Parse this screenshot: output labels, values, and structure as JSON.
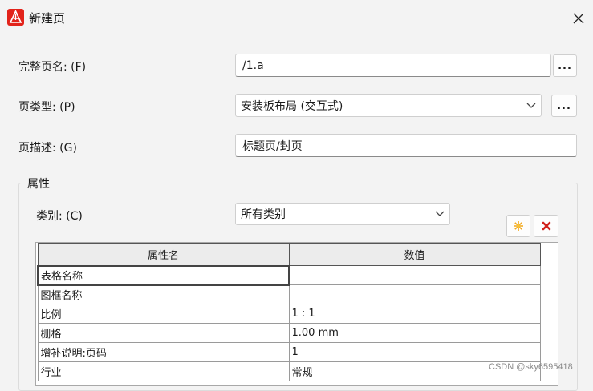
{
  "window": {
    "title": "新建页",
    "app_icon": "eplan-icon",
    "close_icon": "close-icon"
  },
  "form": {
    "full_name_label": "完整页名: (F)",
    "full_name_value": "/1.a",
    "full_name_browse": "...",
    "page_type_label": "页类型: (P)",
    "page_type_value": "安装板布局 (交互式)",
    "page_type_browse": "...",
    "page_desc_label": "页描述: (G)",
    "page_desc_value": "标题页/封页"
  },
  "properties": {
    "group_title": "属性",
    "category_label": "类别: (C)",
    "category_value": "所有类别",
    "new_icon": "sun-star-icon",
    "delete_icon": "delete-x-icon",
    "columns": [
      "属性名",
      "数值"
    ],
    "rows": [
      [
        "表格名称",
        ""
      ],
      [
        "图框名称",
        ""
      ],
      [
        "比例",
        "1 : 1"
      ],
      [
        "栅格",
        "1.00 mm"
      ],
      [
        "增补说明:页码",
        "1"
      ],
      [
        "行业",
        "常规"
      ]
    ]
  },
  "watermark": "CSDN @sky6595418",
  "colors": {
    "accent_red": "#e2231a",
    "background": "#f3f3f3"
  }
}
